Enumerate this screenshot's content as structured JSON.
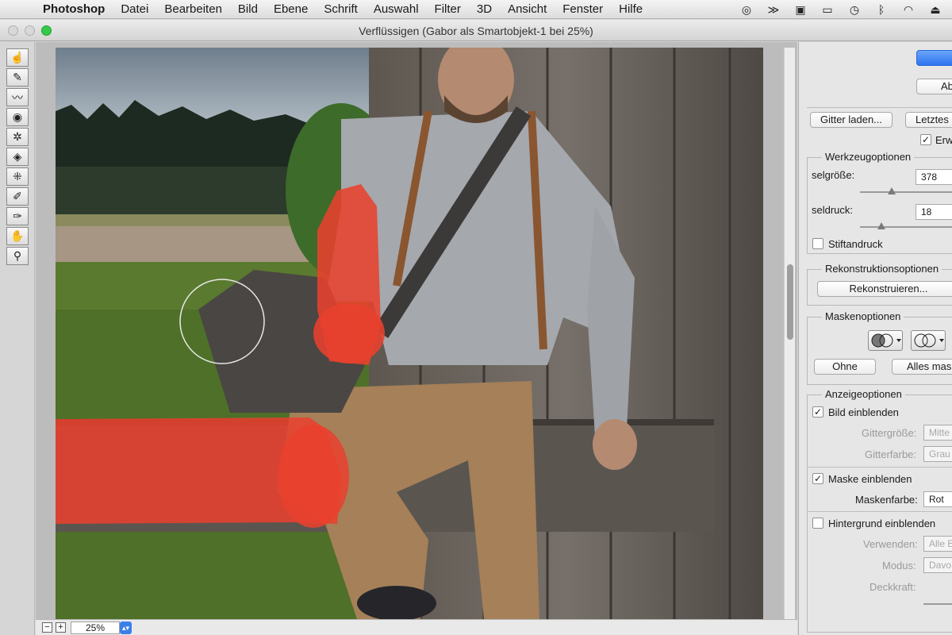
{
  "menubar": {
    "app": "Photoshop",
    "items": [
      "Datei",
      "Bearbeiten",
      "Bild",
      "Ebene",
      "Schrift",
      "Auswahl",
      "Filter",
      "3D",
      "Ansicht",
      "Fenster",
      "Hilfe"
    ],
    "tray_icons": [
      "creative-cloud-icon",
      "hand-icon",
      "display-icon",
      "airplay-icon",
      "time-machine-icon",
      "bluetooth-icon",
      "wifi-icon",
      "eject-icon"
    ]
  },
  "window": {
    "title": "Verflüssigen (Gabor als Smartobjekt-1 bei 25%)"
  },
  "tools": [
    "forward-warp-icon",
    "reconstruct-icon",
    "smooth-icon",
    "twirl-icon",
    "pucker-icon",
    "bloat-icon",
    "push-left-icon",
    "freeze-mask-icon",
    "thaw-mask-icon",
    "hand-icon",
    "zoom-icon"
  ],
  "canvas": {
    "zoom": "25%"
  },
  "panel": {
    "ok_label": "",
    "cancel_label": "Ab",
    "load_mesh_label": "Gitter laden...",
    "last_mesh_label": "Letztes",
    "advanced_label": "Erw",
    "tool_options": {
      "legend": "Werkzeugoptionen",
      "brush_size_label": "selgröße:",
      "brush_size_value": "378",
      "brush_pressure_label": "seldruck:",
      "brush_pressure_value": "18",
      "stylus_label": "Stiftandruck"
    },
    "reconstruct": {
      "legend": "Rekonstruktionsoptionen",
      "button": "Rekonstruieren..."
    },
    "mask": {
      "legend": "Maskenoptionen",
      "none_label": "Ohne",
      "all_label": "Alles mas"
    },
    "view": {
      "legend": "Anzeigeoptionen",
      "show_image": "Bild einblenden",
      "mesh_size_label": "Gittergröße:",
      "mesh_size_value": "Mitte",
      "mesh_color_label": "Gitterfarbe:",
      "mesh_color_value": "Grau",
      "show_mask": "Maske einblenden",
      "mask_color_label": "Maskenfarbe:",
      "mask_color_value": "Rot",
      "show_backdrop": "Hintergrund einblenden",
      "use_label": "Verwenden:",
      "use_value": "Alle E",
      "mode_label": "Modus:",
      "mode_value": "Davo",
      "opacity_label": "Deckkraft:"
    }
  },
  "colors": {
    "mask": "#e8412e",
    "accent": "#2e74ee"
  }
}
